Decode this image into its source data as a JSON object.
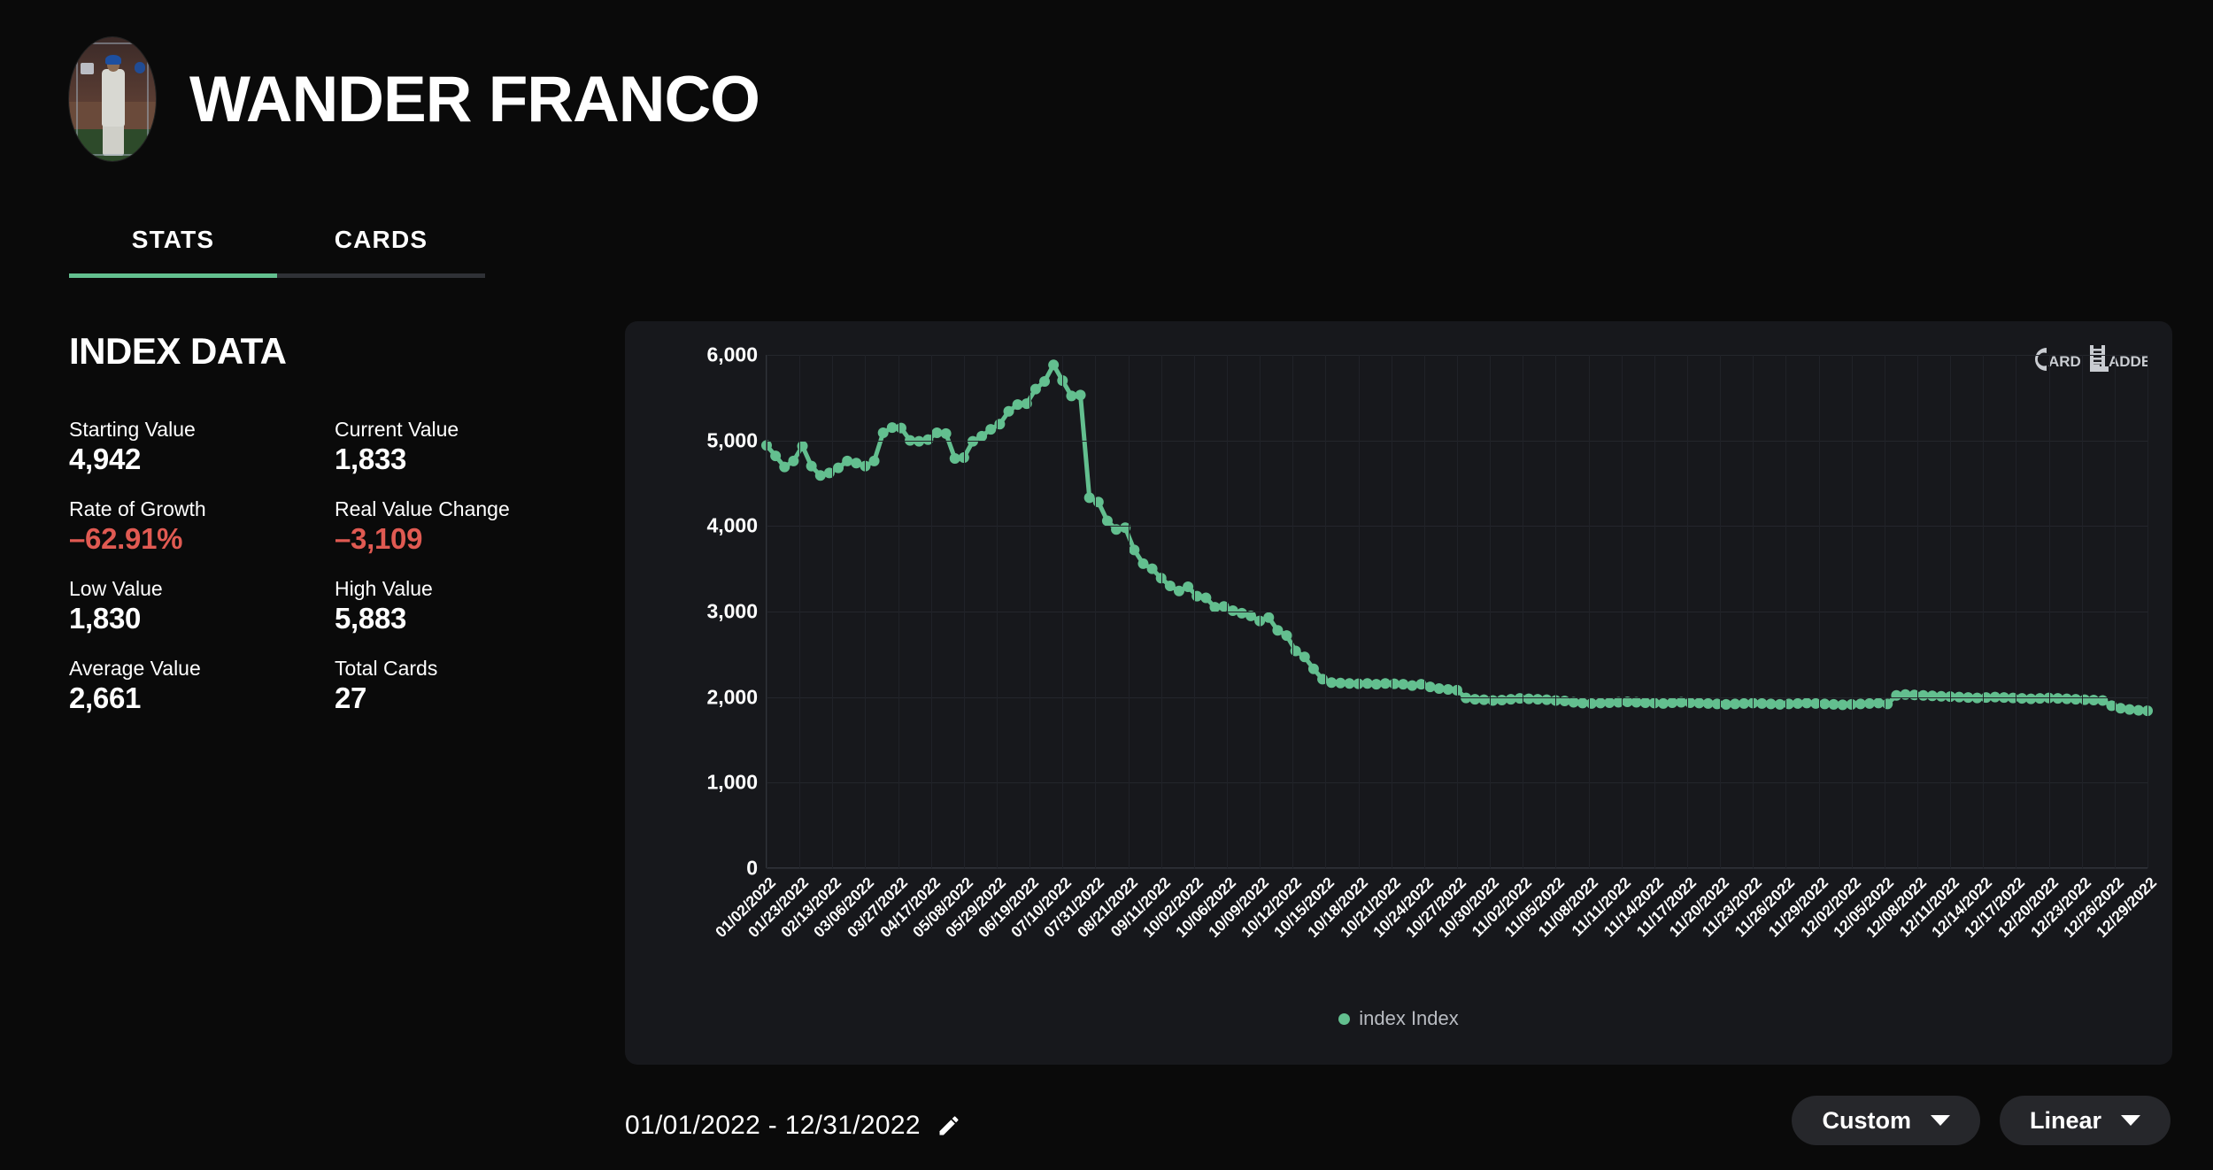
{
  "header": {
    "player_name": "WANDER FRANCO",
    "avatar_alt": "player-card-thumbnail"
  },
  "tabs": [
    {
      "label": "STATS",
      "active": true
    },
    {
      "label": "CARDS",
      "active": false
    }
  ],
  "index_data": {
    "title": "INDEX DATA",
    "stats": [
      {
        "label": "Starting Value",
        "value": "4,942",
        "negative": false
      },
      {
        "label": "Current Value",
        "value": "1,833",
        "negative": false
      },
      {
        "label": "Rate of Growth",
        "value": "–62.91%",
        "negative": true
      },
      {
        "label": "Real Value Change",
        "value": "–3,109",
        "negative": true
      },
      {
        "label": "Low Value",
        "value": "1,830",
        "negative": false
      },
      {
        "label": "High Value",
        "value": "5,883",
        "negative": false
      },
      {
        "label": "Average Value",
        "value": "2,661",
        "negative": false
      },
      {
        "label": "Total Cards",
        "value": "27",
        "negative": false
      }
    ]
  },
  "chart_watermark": {
    "card_text": "ARD",
    "ladder_text": "ADDER",
    "c_letter": "C",
    "l_letter": "L"
  },
  "bottom_bar": {
    "date_range": "01/01/2022 - 12/31/2022",
    "edit_icon": "pencil-icon",
    "dropdowns": [
      {
        "label": "Custom",
        "icon": "chevron-down-icon"
      },
      {
        "label": "Linear",
        "icon": "chevron-down-icon"
      }
    ]
  },
  "chart_data": {
    "type": "line",
    "title": "",
    "xlabel": "",
    "ylabel": "",
    "ylim": [
      0,
      6000
    ],
    "yticks": [
      0,
      1000,
      2000,
      3000,
      4000,
      5000,
      6000
    ],
    "ytick_labels": [
      "0",
      "1,000",
      "2,000",
      "3,000",
      "4,000",
      "5,000",
      "6,000"
    ],
    "grid": true,
    "legend_position": "bottom",
    "accent_color": "#63bf8f",
    "series": [
      {
        "name": "index Index",
        "color": "#63bf8f",
        "values": [
          4942,
          4820,
          4690,
          4760,
          4935,
          4700,
          4590,
          4620,
          4680,
          4760,
          4735,
          4700,
          4760,
          5090,
          5150,
          5145,
          5000,
          4990,
          5010,
          5090,
          5080,
          4790,
          4800,
          4990,
          5050,
          5130,
          5190,
          5340,
          5420,
          5430,
          5600,
          5690,
          5883,
          5700,
          5520,
          5530,
          4330,
          4280,
          4060,
          3960,
          3980,
          3720,
          3560,
          3500,
          3390,
          3300,
          3240,
          3290,
          3180,
          3160,
          3050,
          3060,
          3010,
          2980,
          2950,
          2890,
          2930,
          2780,
          2720,
          2540,
          2470,
          2330,
          2210,
          2170,
          2165,
          2160,
          2155,
          2160,
          2150,
          2160,
          2155,
          2150,
          2135,
          2150,
          2120,
          2100,
          2090,
          2080,
          1990,
          1975,
          1970,
          1960,
          1965,
          1975,
          1985,
          1980,
          1975,
          1970,
          1960,
          1955,
          1940,
          1930,
          1925,
          1930,
          1935,
          1940,
          1945,
          1940,
          1935,
          1930,
          1925,
          1935,
          1940,
          1935,
          1930,
          1925,
          1920,
          1915,
          1920,
          1925,
          1930,
          1925,
          1920,
          1915,
          1920,
          1925,
          1930,
          1925,
          1920,
          1915,
          1910,
          1915,
          1920,
          1925,
          1930,
          1920,
          2020,
          2030,
          2025,
          2020,
          2015,
          2010,
          2005,
          2000,
          1995,
          1990,
          1995,
          2000,
          1995,
          1990,
          1985,
          1980,
          1985,
          1990,
          1985,
          1980,
          1975,
          1970,
          1965,
          1960,
          1900,
          1870,
          1855,
          1845,
          1840
        ]
      }
    ],
    "xtick_labels": [
      "01/02/2022",
      "01/23/2022",
      "02/13/2022",
      "03/06/2022",
      "03/27/2022",
      "04/17/2022",
      "05/08/2022",
      "05/29/2022",
      "06/19/2022",
      "07/10/2022",
      "07/31/2022",
      "08/21/2022",
      "09/11/2022",
      "10/02/2022",
      "10/06/2022",
      "10/09/2022",
      "10/12/2022",
      "10/15/2022",
      "10/18/2022",
      "10/21/2022",
      "10/24/2022",
      "10/27/2022",
      "10/30/2022",
      "11/02/2022",
      "11/05/2022",
      "11/08/2022",
      "11/11/2022",
      "11/14/2022",
      "11/17/2022",
      "11/20/2022",
      "11/23/2022",
      "11/26/2022",
      "11/29/2022",
      "12/02/2022",
      "12/05/2022",
      "12/08/2022",
      "12/11/2022",
      "12/14/2022",
      "12/17/2022",
      "12/20/2022",
      "12/23/2022",
      "12/26/2022",
      "12/29/2022"
    ],
    "legend": [
      {
        "label": "index Index",
        "color": "#63bf8f"
      }
    ]
  }
}
